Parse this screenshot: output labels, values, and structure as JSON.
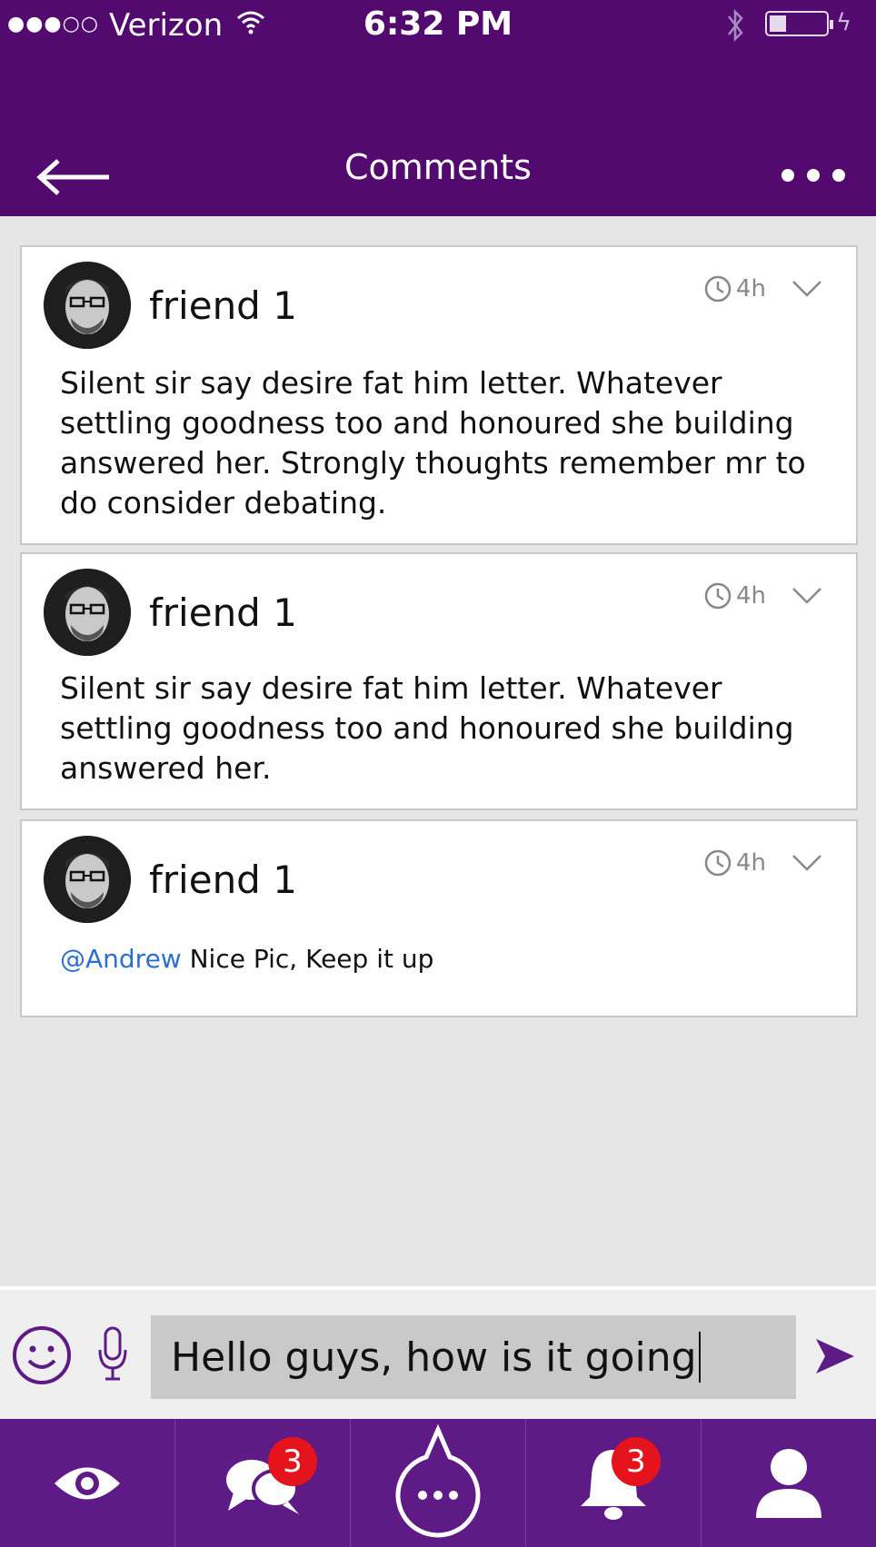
{
  "status_bar": {
    "signal": "●●●○○",
    "carrier": "Verizon",
    "time": "6:32 PM"
  },
  "header": {
    "title": "Comments"
  },
  "comments": [
    {
      "author": "friend 1",
      "time": "4h",
      "text": "Silent sir say desire fat him letter. Whatever settling goodness too and honoured she building answered her. Strongly thoughts remember mr to do consider debating."
    },
    {
      "author": "friend 1",
      "time": "4h",
      "text": "Silent sir say desire fat him letter. Whatever settling goodness too and honoured she building answered her."
    },
    {
      "author": "friend 1",
      "time": "4h",
      "mention": "@Andrew",
      "text": "Nice Pic, Keep it up"
    }
  ],
  "composer": {
    "value": "Hello guys, how is it going"
  },
  "tabbar": {
    "messages_badge": "3",
    "notifications_badge": "3"
  },
  "colors": {
    "header": "#520a6e",
    "tabbar": "#5e1b85",
    "badge": "#e4131c",
    "mention": "#2a6fd1"
  }
}
